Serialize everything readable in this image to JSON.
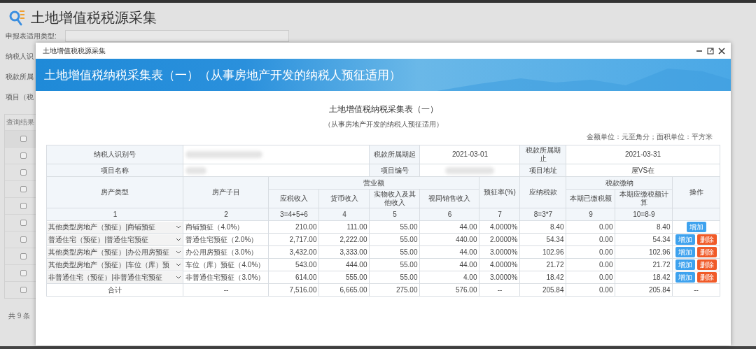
{
  "page": {
    "title": "土地增值税税源采集",
    "form_labels": [
      "申报表适用类型:",
      "纳税人识",
      "税款所属",
      "项目（税"
    ],
    "results_label": "查询结果",
    "result_checkboxes": [
      {
        "checked": false
      },
      {
        "checked": false
      },
      {
        "checked": false
      },
      {
        "checked": false
      },
      {
        "checked": false
      },
      {
        "checked": false
      },
      {
        "checked": false
      },
      {
        "checked": false
      },
      {
        "checked": false
      },
      {
        "checked": false
      }
    ],
    "total": "共 9 条"
  },
  "dialog": {
    "title": "土地增值税税源采集",
    "banner": "土地增值税纳税采集表（一）（从事房地产开发的纳税人预征适用）",
    "form_title": "土地增值税纳税采集表（一）",
    "form_subtitle": "（从事房地产开发的纳税人预征适用）",
    "units": "金额单位：元至角分；面积单位：平方米",
    "info": [
      {
        "label": "纳税人识别号",
        "label2": "税款所属期起",
        "value2": "2021-03-01",
        "label3": "税款所属期止",
        "value3": "2021-03-31"
      },
      {
        "label": "项目名称",
        "label2": "项目编号",
        "label3": "项目地址",
        "value3": "屋VS在"
      }
    ],
    "headers": {
      "type": "房产类型",
      "subitem": "房产子目",
      "revenue": "营业额",
      "revenue_cols": [
        "应税收入",
        "货币收入",
        "实物收入及其他收入",
        "视同销售收入"
      ],
      "rate": "预征率(%)",
      "tax_due": "应纳税款",
      "payment": "税款缴纳",
      "payment_cols": [
        "本期已缴税额",
        "本期应缴税额计算"
      ],
      "ops": "操作"
    },
    "index_row": [
      "1",
      "2",
      "3=4+5+6",
      "4",
      "5",
      "6",
      "7",
      "8=3*7",
      "9",
      "10=8-9"
    ],
    "rows": [
      {
        "type": "其他类型房地产（预征）|商铺预征",
        "subitem": "商铺预征（4.0%）",
        "values": [
          "210.00",
          "111.00",
          "55.00",
          "44.00",
          "4.0000%",
          "8.40",
          "0.00",
          "8.40"
        ],
        "buttons": [
          {
            "kind": "add",
            "label": "增加"
          }
        ]
      },
      {
        "type": "普通住宅（预征）|普通住宅预征",
        "subitem": "普通住宅预征（2.0%）",
        "values": [
          "2,717.00",
          "2,222.00",
          "55.00",
          "440.00",
          "2.0000%",
          "54.34",
          "0.00",
          "54.34"
        ],
        "buttons": [
          {
            "kind": "add",
            "label": "增加"
          },
          {
            "kind": "delete",
            "label": "删除"
          }
        ]
      },
      {
        "type": "其他类型房地产（预征）|办公用房预征",
        "subitem": "办公用房预征（3.0%）",
        "values": [
          "3,432.00",
          "3,333.00",
          "55.00",
          "44.00",
          "3.0000%",
          "102.96",
          "0.00",
          "102.96"
        ],
        "buttons": [
          {
            "kind": "add",
            "label": "增加"
          },
          {
            "kind": "delete",
            "label": "删除"
          }
        ]
      },
      {
        "type": "其他类型房地产（预征）|车位（库）预",
        "subitem": "车位（库）预征（4.0%）",
        "values": [
          "543.00",
          "444.00",
          "55.00",
          "44.00",
          "4.0000%",
          "21.72",
          "0.00",
          "21.72"
        ],
        "buttons": [
          {
            "kind": "add",
            "label": "增加"
          },
          {
            "kind": "delete",
            "label": "删除"
          }
        ]
      },
      {
        "type": "非普通住宅（预征）|非普通住宅预征",
        "subitem": "非普通住宅预征（3.0%）",
        "values": [
          "614.00",
          "555.00",
          "55.00",
          "4.00",
          "3.0000%",
          "18.42",
          "0.00",
          "18.42"
        ],
        "buttons": [
          {
            "kind": "add",
            "label": "增加"
          },
          {
            "kind": "delete",
            "label": "删除"
          }
        ]
      }
    ],
    "total_row": [
      "合计",
      "--",
      "7,516.00",
      "6,665.00",
      "275.00",
      "576.00",
      "--",
      "205.84",
      "0.00",
      "205.84",
      "--"
    ]
  }
}
